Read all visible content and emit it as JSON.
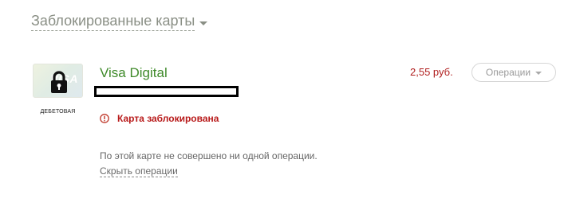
{
  "section": {
    "title": "Заблокированные карты"
  },
  "card": {
    "brand": "VISA",
    "name": "Visa Digital",
    "type_label": "ДЕБЕТОВАЯ",
    "amount": "2,55 руб.",
    "status": "Карта заблокирована",
    "no_operations_text": "По этой карте не совершено ни одной операции.",
    "hide_operations_link": "Скрыть операции"
  },
  "operations_button": {
    "label": "Операции"
  },
  "colors": {
    "card_name": "#3f8a2a",
    "status_red": "#b81a1a",
    "amount_red": "#b01e1e",
    "header_gray": "#8a8f85"
  },
  "icons": {
    "lock": "lock-icon",
    "warning": "warning-icon",
    "section_caret": "chevron-down-icon",
    "operations_caret": "chevron-down-icon"
  }
}
